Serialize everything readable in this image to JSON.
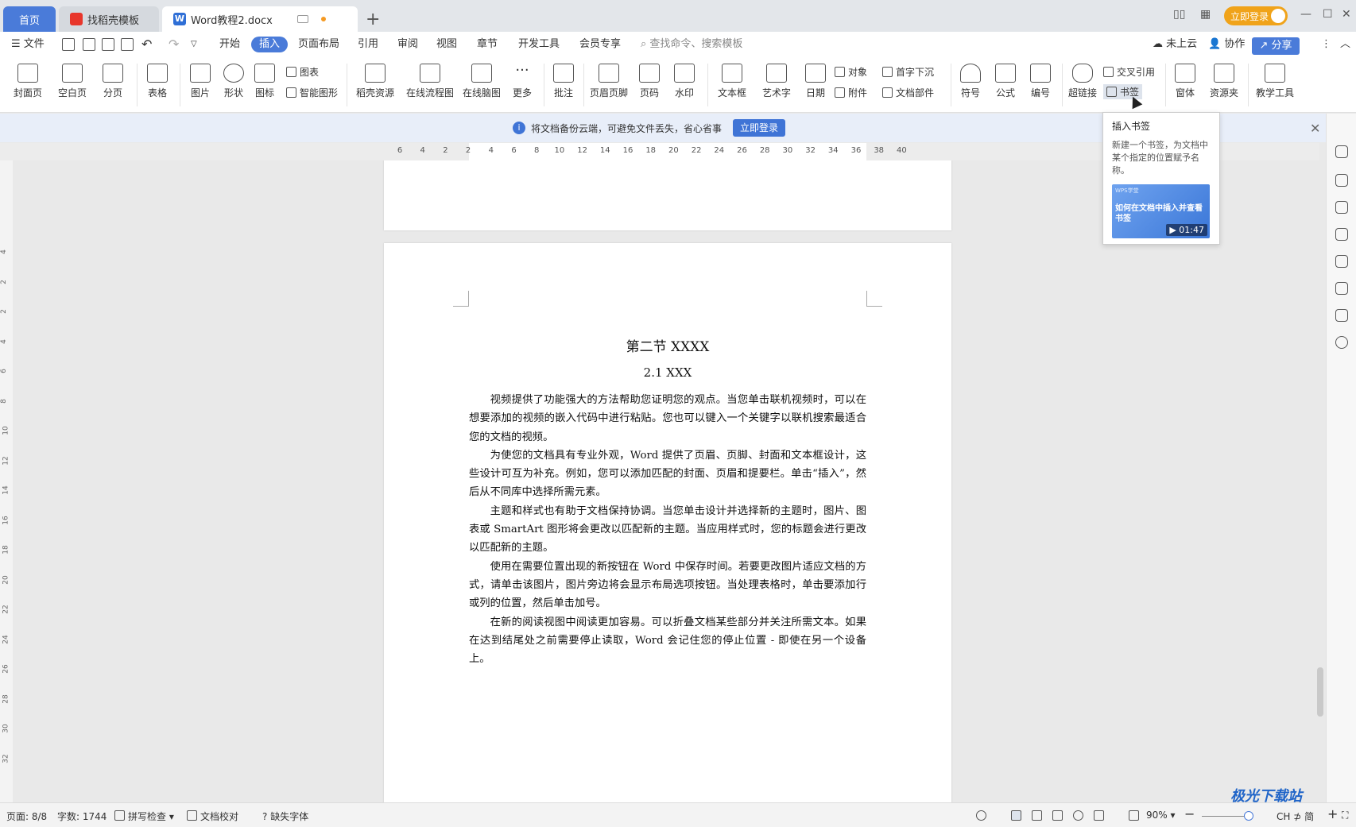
{
  "tabs": {
    "home": "首页",
    "templates": "找稻壳模板",
    "document": "Word教程2.docx"
  },
  "titlebar": {
    "login": "立即登录"
  },
  "menubar": {
    "file": "文件",
    "items": [
      "开始",
      "插入",
      "页面布局",
      "引用",
      "审阅",
      "视图",
      "章节",
      "开发工具",
      "会员专享"
    ],
    "active": "插入",
    "search_placeholder": "查找命令、搜索模板",
    "cloud": "未上云",
    "collab": "协作",
    "share": "分享"
  },
  "ribbon": {
    "cover": "封面页",
    "blank": "空白页",
    "break": "分页",
    "table": "表格",
    "picture": "图片",
    "shape": "形状",
    "icon": "图标",
    "chart": "图表",
    "smartart": "智能图形",
    "docer": "稻壳资源",
    "flowchart": "在线流程图",
    "mindmap": "在线脑图",
    "more": "更多",
    "comment": "批注",
    "header_footer": "页眉页脚",
    "page_number": "页码",
    "watermark": "水印",
    "textbox": "文本框",
    "wordart": "艺术字",
    "date": "日期",
    "object": "对象",
    "attachment": "附件",
    "dropcap": "首字下沉",
    "doc_parts": "文档部件",
    "symbol": "符号",
    "formula": "公式",
    "numbering": "编号",
    "hyperlink": "超链接",
    "cross_ref": "交叉引用",
    "bookmark": "书签",
    "form": "窗体",
    "resources": "资源夹",
    "teaching": "教学工具"
  },
  "notice": {
    "text": "将文档备份云端，可避免文件丢失，省心省事",
    "button": "立即登录"
  },
  "ruler_ticks": [
    "6",
    "4",
    "2",
    "2",
    "4",
    "6",
    "8",
    "10",
    "12",
    "14",
    "16",
    "18",
    "20",
    "22",
    "24",
    "26",
    "28",
    "30",
    "32",
    "34",
    "36",
    "38",
    "40"
  ],
  "vruler_ticks": [
    "4",
    "2",
    "2",
    "4",
    "6",
    "8",
    "10",
    "12",
    "14",
    "16",
    "18",
    "20",
    "22",
    "24",
    "26",
    "28",
    "30",
    "32"
  ],
  "document": {
    "heading1": "第二节  XXXX",
    "heading2": "2.1 XXX",
    "paragraphs": [
      "视频提供了功能强大的方法帮助您证明您的观点。当您单击联机视频时，可以在想要添加的视频的嵌入代码中进行粘贴。您也可以键入一个关键字以联机搜索最适合您的文档的视频。",
      "为使您的文档具有专业外观，Word 提供了页眉、页脚、封面和文本框设计，这些设计可互为补充。例如，您可以添加匹配的封面、页眉和提要栏。单击“插入”，然后从不同库中选择所需元素。",
      "主题和样式也有助于文档保持协调。当您单击设计并选择新的主题时，图片、图表或 SmartArt 图形将会更改以匹配新的主题。当应用样式时，您的标题会进行更改以匹配新的主题。",
      "使用在需要位置出现的新按钮在 Word 中保存时间。若要更改图片适应文档的方式，请单击该图片，图片旁边将会显示布局选项按钮。当处理表格时，单击要添加行或列的位置，然后单击加号。",
      "在新的阅读视图中阅读更加容易。可以折叠文档某些部分并关注所需文本。如果在达到结尾处之前需要停止读取，Word 会记住您的停止位置 - 即使在另一个设备上。"
    ]
  },
  "tooltip": {
    "title": "插入书签",
    "description": "新建一个书签，为文档中某个指定的位置赋予名称。",
    "video_brand": "WPS学堂",
    "video_title": "如何在文档中插入并查看书签",
    "video_duration": "01:47"
  },
  "statusbar": {
    "page": "页面: 8/8",
    "words": "字数: 1744",
    "spell": "拼写检查",
    "proof": "文档校对",
    "missing_font": "缺失字体",
    "zoom": "90%",
    "ime": "CH ⊅ 简"
  },
  "watermark_text": "极光下载站"
}
